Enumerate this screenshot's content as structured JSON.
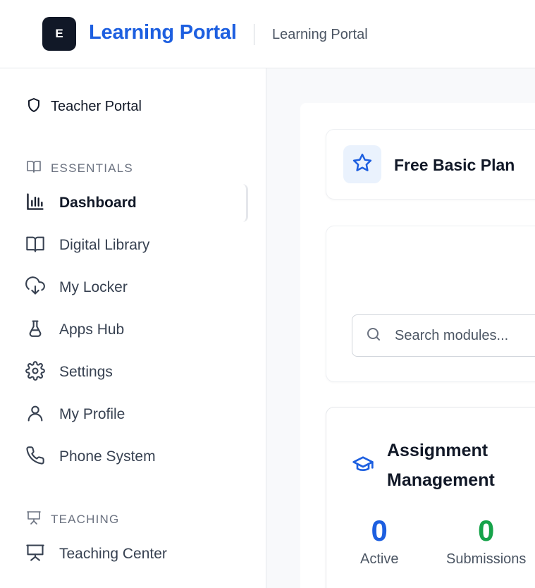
{
  "header": {
    "logo_letter": "E",
    "brand": "Learning Portal",
    "subtitle": "Learning Portal"
  },
  "sidebar": {
    "portal_label": "Teacher Portal",
    "sections": [
      {
        "label": "ESSENTIALS",
        "items": [
          {
            "label": "Dashboard",
            "icon": "bar-chart-icon",
            "active": true
          },
          {
            "label": "Digital Library",
            "icon": "book-icon"
          },
          {
            "label": "My Locker",
            "icon": "cloud-download-icon"
          },
          {
            "label": "Apps Hub",
            "icon": "flask-icon"
          },
          {
            "label": "Settings",
            "icon": "gear-icon"
          },
          {
            "label": "My Profile",
            "icon": "user-icon"
          },
          {
            "label": "Phone System",
            "icon": "phone-icon"
          }
        ]
      },
      {
        "label": "TEACHING",
        "items": [
          {
            "label": "Teaching Center",
            "icon": "presentation-icon"
          }
        ]
      }
    ]
  },
  "plan": {
    "label": "Free Basic Plan",
    "icon": "star-icon"
  },
  "search": {
    "placeholder": "Search modules...",
    "value": ""
  },
  "assignment": {
    "title": "Assignment Management",
    "icon": "graduation-cap-icon",
    "stats": [
      {
        "value": "0",
        "label": "Active",
        "color": "#1d5fe0"
      },
      {
        "value": "0",
        "label": "Submissions",
        "color": "#16a34a"
      }
    ]
  },
  "colors": {
    "accent": "#1d5fe0",
    "success": "#16a34a",
    "logo_bg": "#111827"
  }
}
